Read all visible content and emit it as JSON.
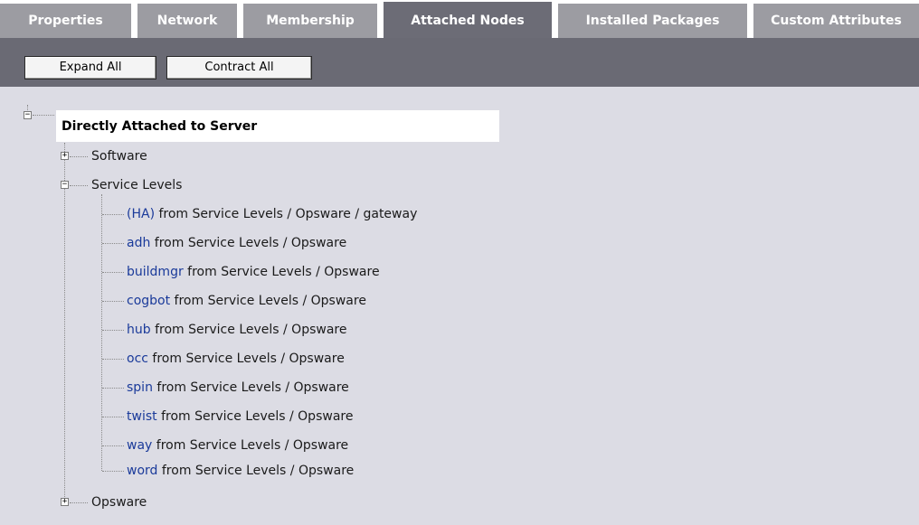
{
  "tabs": [
    {
      "label": "Properties",
      "active": false
    },
    {
      "label": "Network",
      "active": false
    },
    {
      "label": "Membership",
      "active": false
    },
    {
      "label": "Attached Nodes",
      "active": true
    },
    {
      "label": "Installed Packages",
      "active": false
    },
    {
      "label": "Custom Attributes",
      "active": false
    }
  ],
  "toolbar": {
    "expand_all_label": "Expand All",
    "contract_all_label": "Contract All"
  },
  "tree": {
    "root_label": "Directly Attached to Server",
    "software_label": "Software",
    "service_levels_label": "Service Levels",
    "opsware_label": "Opsware",
    "service_level_items": [
      {
        "name": "(HA)",
        "path": "from Service Levels / Opsware / gateway"
      },
      {
        "name": "adh",
        "path": "from Service Levels / Opsware"
      },
      {
        "name": "buildmgr",
        "path": "from Service Levels / Opsware"
      },
      {
        "name": "cogbot",
        "path": "from Service Levels / Opsware"
      },
      {
        "name": "hub",
        "path": "from Service Levels / Opsware"
      },
      {
        "name": "occ",
        "path": "from Service Levels / Opsware"
      },
      {
        "name": "spin",
        "path": "from Service Levels / Opsware"
      },
      {
        "name": "twist",
        "path": "from Service Levels / Opsware"
      },
      {
        "name": "way",
        "path": "from Service Levels / Opsware"
      },
      {
        "name": "word",
        "path": "from Service Levels / Opsware"
      }
    ]
  },
  "icons": {
    "expand": "plus-box-icon",
    "collapse": "minus-box-icon"
  },
  "colors": {
    "tab_inactive": "#9c9ca2",
    "tab_active": "#6c6c76",
    "toolbar": "#6a6a74",
    "content_bg": "#dcdce4",
    "link": "#1a3a9a"
  }
}
